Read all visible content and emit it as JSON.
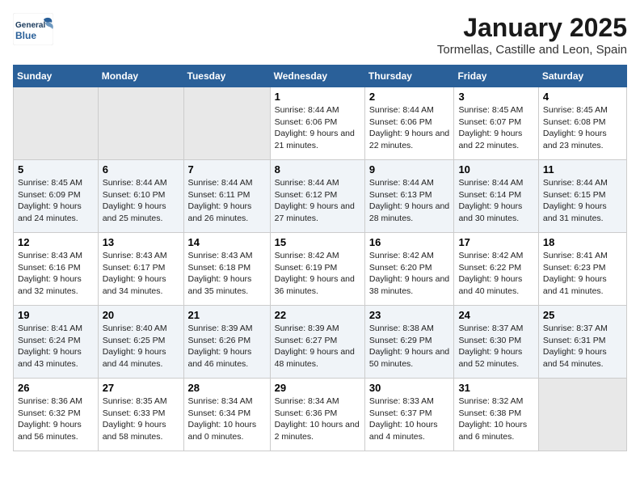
{
  "logo": {
    "line1": "General",
    "line2": "Blue"
  },
  "title": "January 2025",
  "subtitle": "Tormellas, Castille and Leon, Spain",
  "headers": [
    "Sunday",
    "Monday",
    "Tuesday",
    "Wednesday",
    "Thursday",
    "Friday",
    "Saturday"
  ],
  "weeks": [
    [
      {
        "day": "",
        "empty": true
      },
      {
        "day": "",
        "empty": true
      },
      {
        "day": "",
        "empty": true
      },
      {
        "day": "1",
        "rise": "8:44 AM",
        "set": "6:06 PM",
        "daylight": "9 hours and 21 minutes."
      },
      {
        "day": "2",
        "rise": "8:44 AM",
        "set": "6:06 PM",
        "daylight": "9 hours and 22 minutes."
      },
      {
        "day": "3",
        "rise": "8:45 AM",
        "set": "6:07 PM",
        "daylight": "9 hours and 22 minutes."
      },
      {
        "day": "4",
        "rise": "8:45 AM",
        "set": "6:08 PM",
        "daylight": "9 hours and 23 minutes."
      }
    ],
    [
      {
        "day": "5",
        "rise": "8:45 AM",
        "set": "6:09 PM",
        "daylight": "9 hours and 24 minutes."
      },
      {
        "day": "6",
        "rise": "8:44 AM",
        "set": "6:10 PM",
        "daylight": "9 hours and 25 minutes."
      },
      {
        "day": "7",
        "rise": "8:44 AM",
        "set": "6:11 PM",
        "daylight": "9 hours and 26 minutes."
      },
      {
        "day": "8",
        "rise": "8:44 AM",
        "set": "6:12 PM",
        "daylight": "9 hours and 27 minutes."
      },
      {
        "day": "9",
        "rise": "8:44 AM",
        "set": "6:13 PM",
        "daylight": "9 hours and 28 minutes."
      },
      {
        "day": "10",
        "rise": "8:44 AM",
        "set": "6:14 PM",
        "daylight": "9 hours and 30 minutes."
      },
      {
        "day": "11",
        "rise": "8:44 AM",
        "set": "6:15 PM",
        "daylight": "9 hours and 31 minutes."
      }
    ],
    [
      {
        "day": "12",
        "rise": "8:43 AM",
        "set": "6:16 PM",
        "daylight": "9 hours and 32 minutes."
      },
      {
        "day": "13",
        "rise": "8:43 AM",
        "set": "6:17 PM",
        "daylight": "9 hours and 34 minutes."
      },
      {
        "day": "14",
        "rise": "8:43 AM",
        "set": "6:18 PM",
        "daylight": "9 hours and 35 minutes."
      },
      {
        "day": "15",
        "rise": "8:42 AM",
        "set": "6:19 PM",
        "daylight": "9 hours and 36 minutes."
      },
      {
        "day": "16",
        "rise": "8:42 AM",
        "set": "6:20 PM",
        "daylight": "9 hours and 38 minutes."
      },
      {
        "day": "17",
        "rise": "8:42 AM",
        "set": "6:22 PM",
        "daylight": "9 hours and 40 minutes."
      },
      {
        "day": "18",
        "rise": "8:41 AM",
        "set": "6:23 PM",
        "daylight": "9 hours and 41 minutes."
      }
    ],
    [
      {
        "day": "19",
        "rise": "8:41 AM",
        "set": "6:24 PM",
        "daylight": "9 hours and 43 minutes."
      },
      {
        "day": "20",
        "rise": "8:40 AM",
        "set": "6:25 PM",
        "daylight": "9 hours and 44 minutes."
      },
      {
        "day": "21",
        "rise": "8:39 AM",
        "set": "6:26 PM",
        "daylight": "9 hours and 46 minutes."
      },
      {
        "day": "22",
        "rise": "8:39 AM",
        "set": "6:27 PM",
        "daylight": "9 hours and 48 minutes."
      },
      {
        "day": "23",
        "rise": "8:38 AM",
        "set": "6:29 PM",
        "daylight": "9 hours and 50 minutes."
      },
      {
        "day": "24",
        "rise": "8:37 AM",
        "set": "6:30 PM",
        "daylight": "9 hours and 52 minutes."
      },
      {
        "day": "25",
        "rise": "8:37 AM",
        "set": "6:31 PM",
        "daylight": "9 hours and 54 minutes."
      }
    ],
    [
      {
        "day": "26",
        "rise": "8:36 AM",
        "set": "6:32 PM",
        "daylight": "9 hours and 56 minutes."
      },
      {
        "day": "27",
        "rise": "8:35 AM",
        "set": "6:33 PM",
        "daylight": "9 hours and 58 minutes."
      },
      {
        "day": "28",
        "rise": "8:34 AM",
        "set": "6:34 PM",
        "daylight": "10 hours and 0 minutes."
      },
      {
        "day": "29",
        "rise": "8:34 AM",
        "set": "6:36 PM",
        "daylight": "10 hours and 2 minutes."
      },
      {
        "day": "30",
        "rise": "8:33 AM",
        "set": "6:37 PM",
        "daylight": "10 hours and 4 minutes."
      },
      {
        "day": "31",
        "rise": "8:32 AM",
        "set": "6:38 PM",
        "daylight": "10 hours and 6 minutes."
      },
      {
        "day": "",
        "empty": true
      }
    ]
  ]
}
